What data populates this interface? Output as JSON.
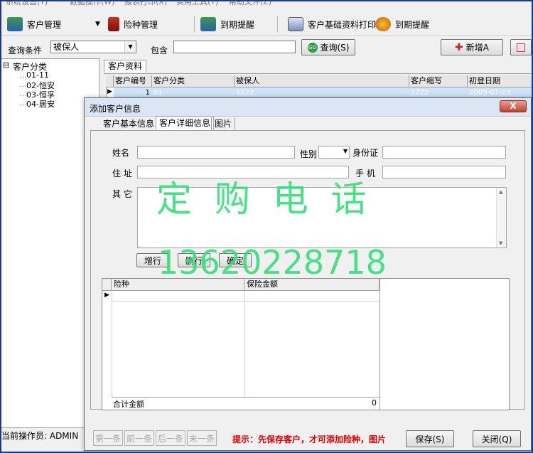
{
  "menu": [
    "系统设置(Y)",
    "数据操作(W)",
    "报表打印(X)",
    "实用工具(Y)",
    "帮助文件(Z)"
  ],
  "toolbar": {
    "customer_mgmt": "客户管理",
    "insurance_mgmt": "险种管理",
    "expiry_reminder": "到期提醒",
    "print_basic": "客户基础资料打印",
    "expiry_reminder2": "到期提醒"
  },
  "query": {
    "label": "查询条件",
    "field_value": "被保人",
    "contains_label": "包含",
    "contains_value": "",
    "search_button": "查询(S)",
    "add_button": "新增A"
  },
  "tree": {
    "root": "客户分类",
    "items": [
      "01-11",
      "02-恒安",
      "03-恒孚",
      "04-居安"
    ]
  },
  "main_tab": "客户资料",
  "grid": {
    "headers": [
      "客户编号",
      "客户分类",
      "被保人",
      "客户缩写",
      "初登日期"
    ],
    "row": [
      "1",
      "01",
      "1222",
      "1222",
      "2009-07-23"
    ]
  },
  "status": {
    "operator": "当前操作员: ADMIN"
  },
  "dialog": {
    "title": "添加客户信息",
    "close": "X",
    "tabs": [
      "客户基本信息",
      "客户详细信息",
      "图片"
    ],
    "fields": {
      "name_label": "姓名",
      "gender_label": "性别",
      "id_label": "身份证",
      "address_label": "住 址",
      "mobile_label": "手 机",
      "other_label": "其 它"
    },
    "buttons": {
      "add_row": "增行",
      "delete_row": "删行",
      "confirm": "确定"
    },
    "detail_grid": {
      "headers": [
        "险种",
        "保险金额"
      ],
      "total_label": "合计金额",
      "total_value": "0"
    },
    "nav": [
      "第一条",
      "前一条",
      "后一条",
      "末一条"
    ],
    "hint": "提示：先保存客户，才可添加险种，图片",
    "save": "保存(S)",
    "close_button": "关闭(Q)"
  },
  "watermark": {
    "line1": "定 购 电 话",
    "line2": "13620228718"
  },
  "colors": {
    "watermark": "#33e07a",
    "hint": "#e00000",
    "selection": "#cde3f8"
  }
}
